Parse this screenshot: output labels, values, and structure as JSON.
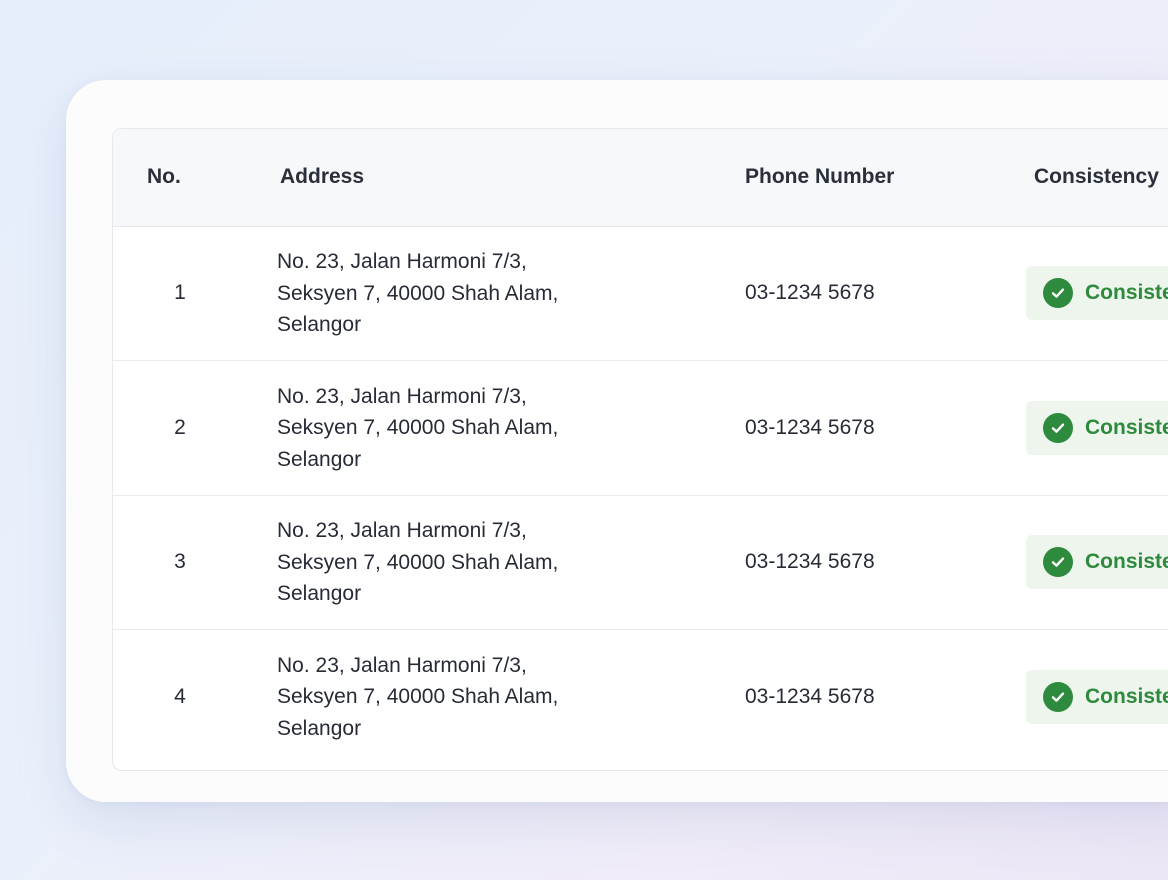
{
  "table": {
    "headers": {
      "no": "No.",
      "address": "Address",
      "phone": "Phone Number",
      "consistency": "Consistency"
    },
    "rows": [
      {
        "no": "1",
        "address": [
          "No. 23, Jalan Harmoni 7/3,",
          "Seksyen 7, 40000 Shah Alam,",
          "Selangor"
        ],
        "phone": "03-1234 5678",
        "status": "Consistent",
        "status_icon": "check-circle-icon"
      },
      {
        "no": "2",
        "address": [
          "No. 23, Jalan Harmoni 7/3,",
          "Seksyen 7, 40000 Shah Alam,",
          "Selangor"
        ],
        "phone": "03-1234 5678",
        "status": "Consistent",
        "status_icon": "check-circle-icon"
      },
      {
        "no": "3",
        "address": [
          "No. 23, Jalan Harmoni 7/3,",
          "Seksyen 7, 40000 Shah Alam,",
          "Selangor"
        ],
        "phone": "03-1234 5678",
        "status": "Consistent",
        "status_icon": "check-circle-icon"
      },
      {
        "no": "4",
        "address": [
          "No. 23, Jalan Harmoni 7/3,",
          "Seksyen 7, 40000 Shah Alam,",
          "Selangor"
        ],
        "phone": "03-1234 5678",
        "status": "Consistent",
        "status_icon": "check-circle-icon"
      }
    ]
  },
  "colors": {
    "status_green": "#2e8a3d",
    "status_bg": "#edf5ec",
    "header_bg": "#f7f8fa"
  }
}
